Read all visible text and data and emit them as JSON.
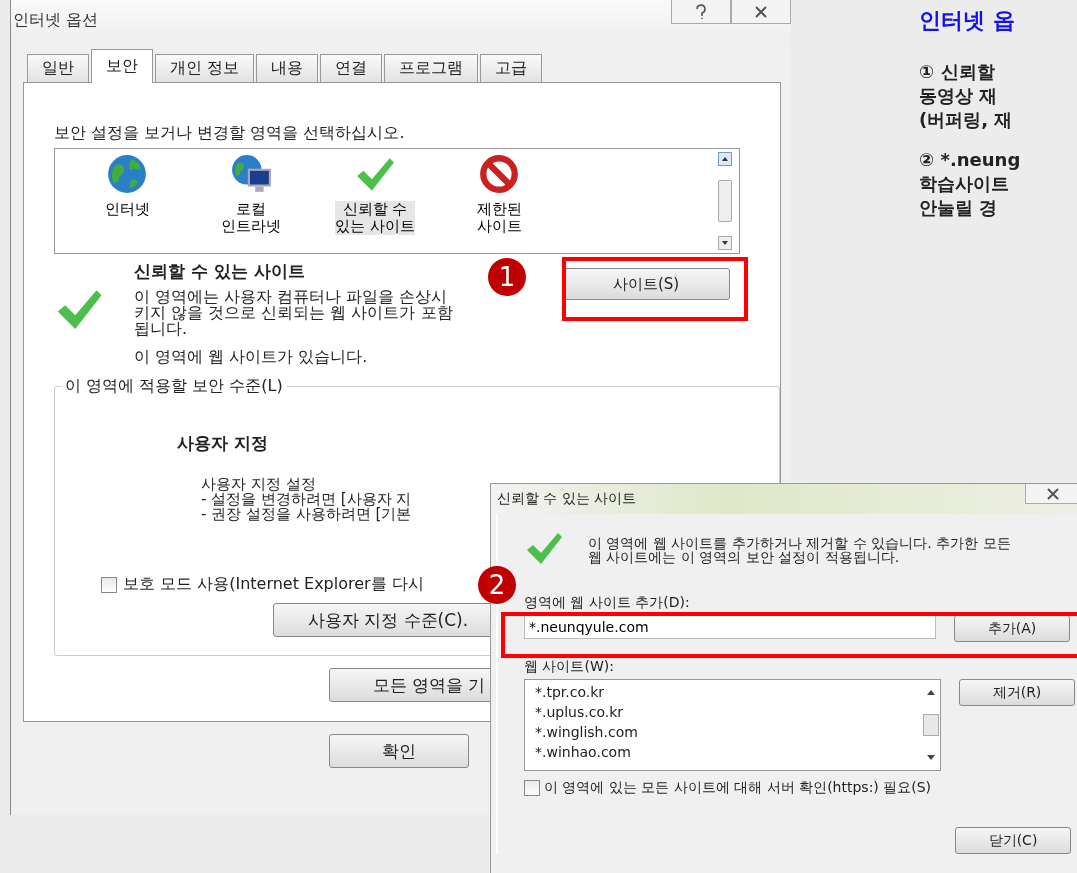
{
  "main_dialog": {
    "title": "인터넷 옵션",
    "tabs": [
      {
        "label": "일반",
        "selected": false
      },
      {
        "label": "보안",
        "selected": true
      },
      {
        "label": "개인 정보",
        "selected": false
      },
      {
        "label": "내용",
        "selected": false
      },
      {
        "label": "연결",
        "selected": false
      },
      {
        "label": "프로그램",
        "selected": false
      },
      {
        "label": "고급",
        "selected": false
      }
    ],
    "zone_prompt": "보안 설정을 보거나 변경할 영역을 선택하십시오.",
    "zones": [
      {
        "kind": "globe",
        "lines": [
          "인터넷"
        ],
        "selected": false
      },
      {
        "kind": "intranet",
        "lines": [
          "로컬",
          "인트라넷"
        ],
        "selected": false
      },
      {
        "kind": "check",
        "lines": [
          "신뢰할 수",
          "있는 사이트"
        ],
        "selected": true
      },
      {
        "kind": "blocked",
        "lines": [
          "제한된",
          "사이트"
        ],
        "selected": false
      }
    ],
    "zone_title": "신뢰할 수 있는 사이트",
    "zone_description": [
      "이 영역에는 사용자 컴퓨터나 파일을 손상시",
      "키지 않을 것으로 신뢰되는 웹 사이트가 포함",
      "됩니다."
    ],
    "zone_note": "이 영역에 웹 사이트가 있습니다.",
    "sites_button": "사이트(S)",
    "level_group": {
      "legend": "이 영역에 적용할 보안 수준(L)",
      "level_name": "사용자 지정",
      "lines": [
        "사용자 지정 설정",
        "- 설정을 변경하려면 [사용자 지",
        "- 권장 설정을 사용하려면 [기본"
      ]
    },
    "protected_mode": {
      "label": "보호 모드 사용(Internet Explorer를 다시",
      "checked": false
    },
    "custom_level_button": "사용자 지정 수준(C).",
    "reset_button": "모든 영역을 기",
    "ok_button": "확인"
  },
  "callouts": [
    {
      "number": "1"
    },
    {
      "number": "2"
    }
  ],
  "instructions": {
    "title": "인터넷 옵",
    "paragraphs": [
      {
        "lines": [
          "① 신뢰할",
          "동영상 재",
          "(버퍼링, 재"
        ]
      },
      {
        "lines": [
          "② *.neung",
          "학습사이트",
          "안눌릴 경"
        ]
      }
    ]
  },
  "trusted_dialog": {
    "title": "신뢰할 수 있는 사이트",
    "message": [
      "이 영역에 웹 사이트를 추가하거나 제거할 수 있습니다. 추가한 모든",
      "웹 사이트에는 이 영역의 보안 설정이 적용됩니다."
    ],
    "add_label": "영역에 웹 사이트 추가(D):",
    "add_value": "*.neunqyule.com",
    "add_button": "추가(A)",
    "list_label": "웹 사이트(W):",
    "sites": [
      "*.tpr.co.kr",
      "*.uplus.co.kr",
      "*.winglish.com",
      "*.winhao.com"
    ],
    "remove_button": "제거(R)",
    "https_check": {
      "label": "이 영역에 있는 모든 사이트에 대해 서버 확인(https:) 필요(S)",
      "checked": false
    },
    "close_button": "닫기(C)"
  }
}
